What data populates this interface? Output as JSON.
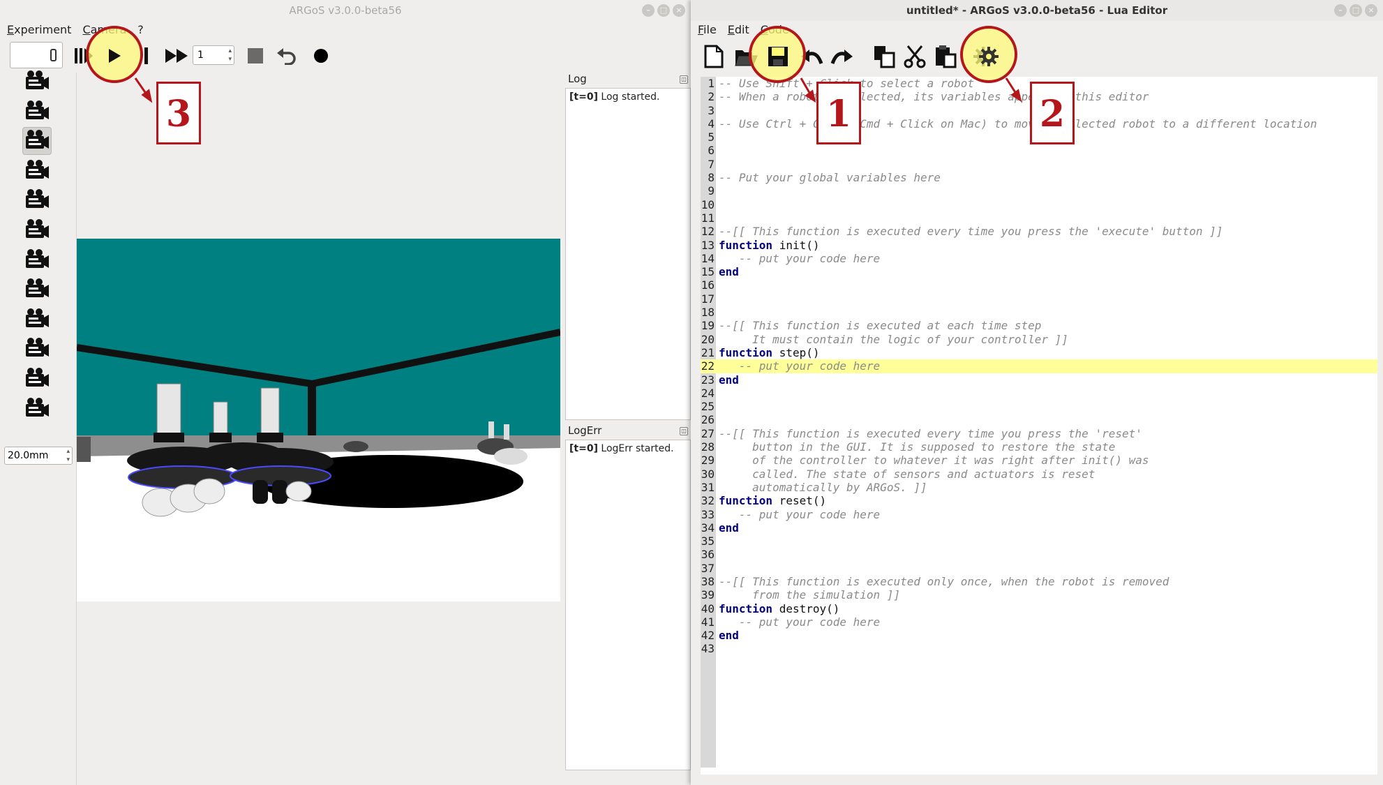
{
  "left_window": {
    "title": "ARGoS v3.0.0-beta56",
    "menu": [
      "Experiment",
      "Camera",
      "?"
    ],
    "step_value": "1",
    "zoom_value": "20.0mm",
    "log": {
      "title": "Log",
      "time": "[t=0]",
      "text": " Log started."
    },
    "logerr": {
      "title": "LogErr",
      "time": "[t=0]",
      "text": " LogErr started."
    }
  },
  "right_window": {
    "title": "untitled* - ARGoS v3.0.0-beta56 - Lua Editor",
    "menu": [
      "File",
      "Edit",
      "Code"
    ],
    "highlighted_line": 22,
    "code_lines": [
      [
        [
          "c",
          "-- Use Shift + Click to select a robot"
        ]
      ],
      [
        [
          "c",
          "-- When a robot is selected, its variables appear in this editor"
        ]
      ],
      [],
      [
        [
          "c",
          "-- Use Ctrl + Click (Cmd + Click on Mac) to move a selected robot to a different location"
        ]
      ],
      [],
      [],
      [],
      [
        [
          "c",
          "-- Put your global variables here"
        ]
      ],
      [],
      [],
      [],
      [
        [
          "c",
          "--[[ This function is executed every time you press the 'execute' button ]]"
        ]
      ],
      [
        [
          "k",
          "function"
        ],
        [
          "p",
          " init()"
        ]
      ],
      [
        [
          "c",
          "   -- put your code here"
        ]
      ],
      [
        [
          "k",
          "end"
        ]
      ],
      [],
      [],
      [],
      [
        [
          "c",
          "--[[ This function is executed at each time step"
        ]
      ],
      [
        [
          "c",
          "     It must contain the logic of your controller ]]"
        ]
      ],
      [
        [
          "k",
          "function"
        ],
        [
          "p",
          " step()"
        ]
      ],
      [
        [
          "c",
          "   -- put your code here"
        ]
      ],
      [
        [
          "k",
          "end"
        ]
      ],
      [],
      [],
      [],
      [
        [
          "c",
          "--[[ This function is executed every time you press the 'reset'"
        ]
      ],
      [
        [
          "c",
          "     button in the GUI. It is supposed to restore the state"
        ]
      ],
      [
        [
          "c",
          "     of the controller to whatever it was right after init() was"
        ]
      ],
      [
        [
          "c",
          "     called. The state of sensors and actuators is reset"
        ]
      ],
      [
        [
          "c",
          "     automatically by ARGoS. ]]"
        ]
      ],
      [
        [
          "k",
          "function"
        ],
        [
          "p",
          " reset()"
        ]
      ],
      [
        [
          "c",
          "   -- put your code here"
        ]
      ],
      [
        [
          "k",
          "end"
        ]
      ],
      [],
      [],
      [],
      [
        [
          "c",
          "--[[ This function is executed only once, when the robot is removed"
        ]
      ],
      [
        [
          "c",
          "     from the simulation ]]"
        ]
      ],
      [
        [
          "k",
          "function"
        ],
        [
          "p",
          " destroy()"
        ]
      ],
      [
        [
          "c",
          "   -- put your code here"
        ]
      ],
      [
        [
          "k",
          "end"
        ]
      ],
      []
    ]
  },
  "annotations": {
    "label_1": "1",
    "label_2": "2",
    "label_3": "3"
  },
  "colors": {
    "annotation_red": "#b4161b",
    "annotation_yellow": "#fffa78",
    "arena_wall": "#008080",
    "highlight_line": "#ffff99"
  },
  "icons": [
    "play-icon",
    "pause-icon",
    "step-icon",
    "fast-forward-icon",
    "stop-icon",
    "undo-icon",
    "record-icon",
    "camera-icon",
    "new-file-icon",
    "open-folder-icon",
    "save-icon",
    "redo-icon",
    "copy-icon",
    "cut-icon",
    "paste-icon",
    "gear-icon"
  ]
}
